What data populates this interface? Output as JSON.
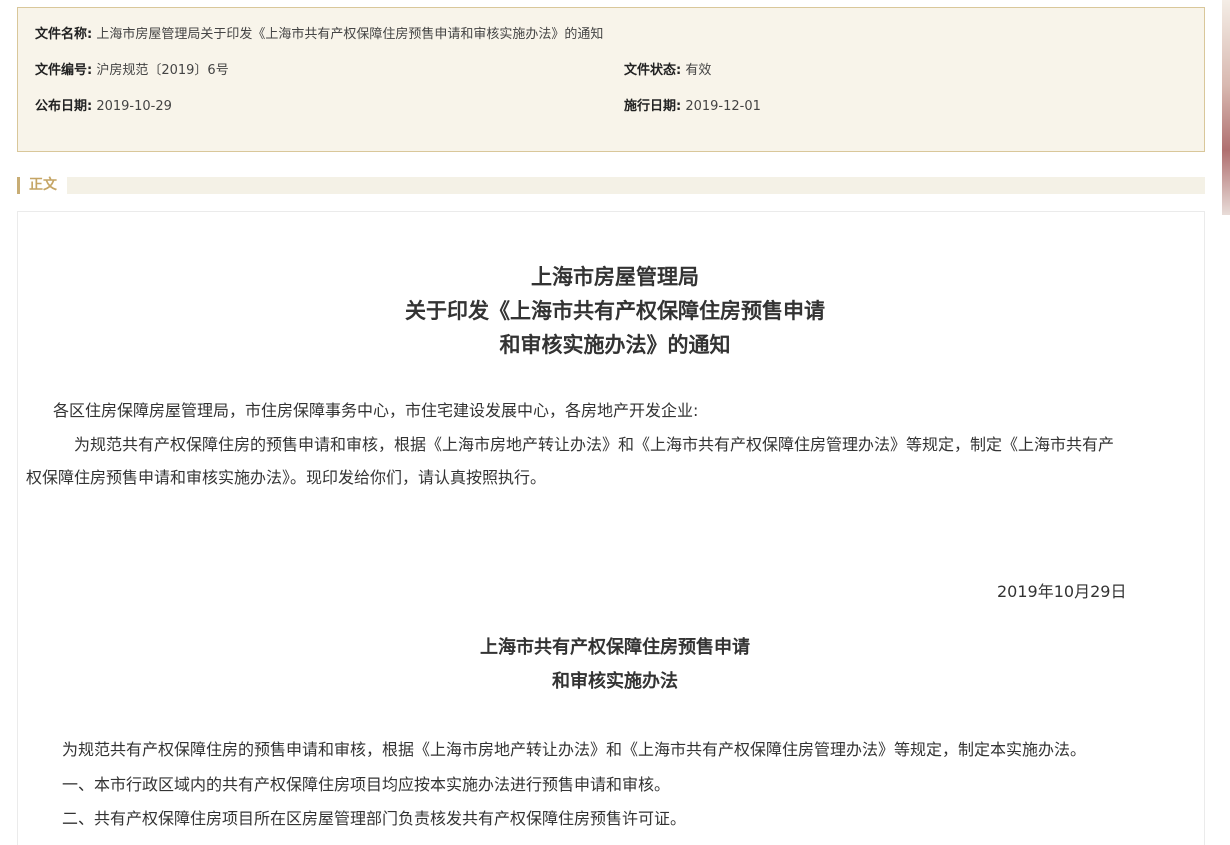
{
  "meta": {
    "doc_name_label": "文件名称:",
    "doc_name": "上海市房屋管理局关于印发《上海市共有产权保障住房预售申请和审核实施办法》的通知",
    "doc_no_label": "文件编号:",
    "doc_no": "沪房规范〔2019〕6号",
    "status_label": "文件状态:",
    "status": "有效",
    "publish_label": "公布日期:",
    "publish_date": "2019-10-29",
    "effective_label": "施行日期:",
    "effective_date": "2019-12-01"
  },
  "section": {
    "label": "正文"
  },
  "notice": {
    "title_line1": "上海市房屋管理局",
    "title_line2": "关于印发《上海市共有产权保障住房预售申请",
    "title_line3": "和审核实施办法》的通知",
    "recipients": "各区住房保障房屋管理局，市住房保障事务中心，市住宅建设发展中心，各房地产开发企业:",
    "body_line1": "为规范共有产权保障住房的预售申请和审核，根据《上海市房地产转让办法》和《上海市共有产权保障住房管理办法》等规定，制定《上海市共有产",
    "body_line2": "权保障住房预售申请和审核实施办法》。现印发给你们，请认真按照执行。",
    "date": "2019年10月29日"
  },
  "measures": {
    "title_line1": "上海市共有产权保障住房预售申请",
    "title_line2": "和审核实施办法",
    "intro": "为规范共有产权保障住房的预售申请和审核，根据《上海市房地产转让办法》和《上海市共有产权保障住房管理办法》等规定，制定本实施办法。",
    "item1": "一、本市行政区域内的共有产权保障住房项目均应按本实施办法进行预售申请和审核。",
    "item2": "二、共有产权保障住房项目所在区房屋管理部门负责核发共有产权保障住房预售许可证。"
  }
}
